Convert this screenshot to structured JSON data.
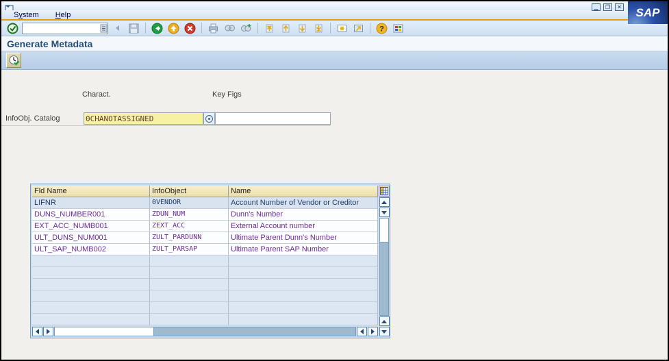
{
  "window": {
    "logo_text": "SAP"
  },
  "menu": {
    "system": {
      "pre": "S",
      "accel": "y",
      "post": "stem"
    },
    "help": {
      "pre": "",
      "accel": "H",
      "post": "elp"
    }
  },
  "toolbar": {
    "command_value": "",
    "icon_names": [
      "enter-icon",
      "command-combo-icon",
      "collapse-icon",
      "save-icon",
      "back-icon",
      "exit-icon",
      "cancel-icon",
      "print-icon",
      "find-icon",
      "find-next-icon",
      "first-page-icon",
      "previous-page-icon",
      "next-page-icon",
      "last-page-icon",
      "new-session-icon",
      "shortcut-icon",
      "help-icon",
      "customize-layout-icon"
    ]
  },
  "page": {
    "title": "Generate Metadata"
  },
  "app_toolbar": {
    "execute_icon": "execute-icon"
  },
  "form": {
    "charact_label": "Charact.",
    "keyfigs_label": "Key Figs",
    "catalog_label": "InfoObj. Catalog",
    "catalog_value": "0CHANOTASSIGNED",
    "keyfigs_value": ""
  },
  "table": {
    "columns": [
      "Fld Name",
      "InfoObject",
      "Name"
    ],
    "rows": [
      {
        "fld_name": "LIFNR",
        "infoobject": "0VENDOR",
        "name": "Account Number of Vendor or Creditor",
        "color": "#1e3c68",
        "bg": "#d9e3ef"
      },
      {
        "fld_name": "DUNS_NUMBER001",
        "infoobject": "ZDUN_NUM",
        "name": "Dunn's Number",
        "color": "#6a2c9b",
        "bg": "#fcfdfe"
      },
      {
        "fld_name": "EXT_ACC_NUMB001",
        "infoobject": "ZEXT_ACC",
        "name": "External Account number",
        "color": "#6a2c9b",
        "bg": "#fcfdfe"
      },
      {
        "fld_name": "ULT_DUNS_NUM001",
        "infoobject": "ZULT_PARDUNN",
        "name": "Ultimate Parent Dunn's Number",
        "color": "#6a2c9b",
        "bg": "#fcfdfe"
      },
      {
        "fld_name": "ULT_SAP_NUMB002",
        "infoobject": "ZULT_PARSAP",
        "name": "Ultimate Parent SAP Number",
        "color": "#6a2c9b",
        "bg": "#fcfdfe"
      }
    ],
    "empty_rows": 6,
    "empty_row_bg": "#dce7f3"
  },
  "colors": {
    "accent_orange": "#e99c00",
    "logo_blue": "#1c3a75",
    "header_tan": "#f1e2b0",
    "yellow_field_bg": "#f9f1a2",
    "row_default_text": "#1e3c68",
    "row_changed_text": "#6a2c9b"
  }
}
